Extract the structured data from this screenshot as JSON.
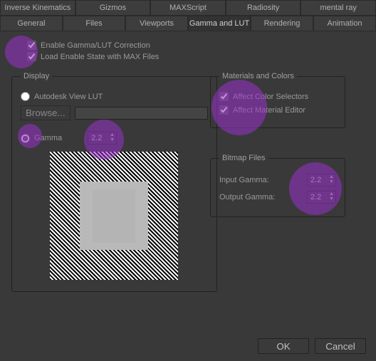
{
  "tabs": {
    "row1": [
      "Inverse Kinematics",
      "Gizmos",
      "MAXScript",
      "Radiosity",
      "mental ray"
    ],
    "row2": [
      "General",
      "Files",
      "Viewports",
      "Gamma and LUT",
      "Rendering",
      "Animation"
    ],
    "active": "Gamma and LUT"
  },
  "checks": {
    "enable_label": "Enable Gamma/LUT Correction",
    "enable_checked": true,
    "load_label": "Load Enable State with MAX Files",
    "load_checked": true
  },
  "display": {
    "legend": "Display",
    "autodesk_label": "Autodesk View LUT",
    "autodesk_selected": false,
    "browse_label": "Browse...",
    "path_value": "",
    "gamma_label": "Gamma",
    "gamma_selected": true,
    "gamma_value": "2.2"
  },
  "materials": {
    "legend": "Materials and Colors",
    "color_selectors_label": "Affect Color Selectors",
    "color_selectors_checked": true,
    "material_editor_label": "Affect Material Editor",
    "material_editor_checked": true
  },
  "bitmap": {
    "legend": "Bitmap Files",
    "input_label": "Input Gamma:",
    "input_value": "2.2",
    "output_label": "Output Gamma:",
    "output_value": "2.2"
  },
  "footer": {
    "ok": "OK",
    "cancel": "Cancel"
  }
}
